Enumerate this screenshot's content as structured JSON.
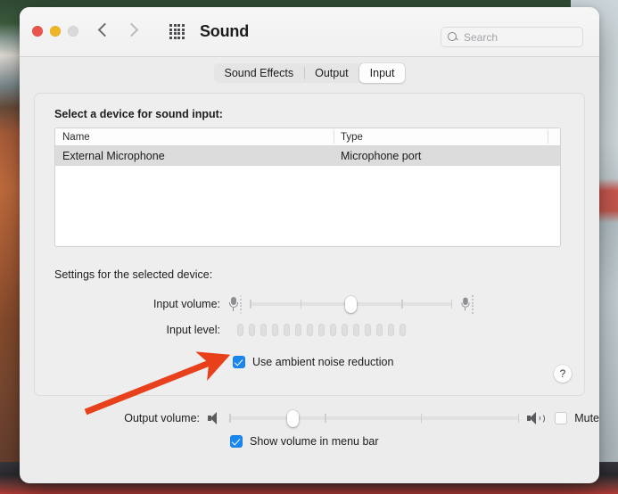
{
  "window": {
    "title": "Sound",
    "traffic_lights": [
      "close",
      "minimize",
      "zoom"
    ],
    "nav_back": "back-chevron",
    "nav_forward": "forward-chevron",
    "grid_icon": "show-all-icon"
  },
  "search": {
    "placeholder": "Search",
    "value": "",
    "icon": "search-icon"
  },
  "tabs": [
    {
      "label": "Sound Effects",
      "active": false
    },
    {
      "label": "Output",
      "active": false
    },
    {
      "label": "Input",
      "active": true
    }
  ],
  "device_section": {
    "heading": "Select a device for sound input:",
    "columns": [
      "Name",
      "Type"
    ],
    "rows": [
      {
        "name": "External Microphone",
        "type": "Microphone port",
        "selected": true
      }
    ]
  },
  "settings_section": {
    "heading": "Settings for the selected device:",
    "input_volume": {
      "label": "Input volume:",
      "value_percent": 50,
      "left_icon": "microphone-icon",
      "right_icon": "microphone-icon"
    },
    "input_level": {
      "label": "Input level:",
      "segments": 15,
      "active_segments": 0
    },
    "ambient_noise": {
      "label": "Use ambient noise reduction",
      "checked": true
    },
    "help": {
      "label": "?",
      "icon": "help-icon"
    }
  },
  "output_section": {
    "output_volume": {
      "label": "Output volume:",
      "value_percent": 22,
      "left_icon": "speaker-mute-icon",
      "right_icon": "speaker-wave-icon"
    },
    "mute": {
      "label": "Mute",
      "checked": false
    },
    "show_volume_menu_bar": {
      "label": "Show volume in menu bar",
      "checked": true
    }
  },
  "annotation": {
    "arrow_color": "#e8401b",
    "points_to": "use-ambient-noise-reduction-checkbox"
  }
}
